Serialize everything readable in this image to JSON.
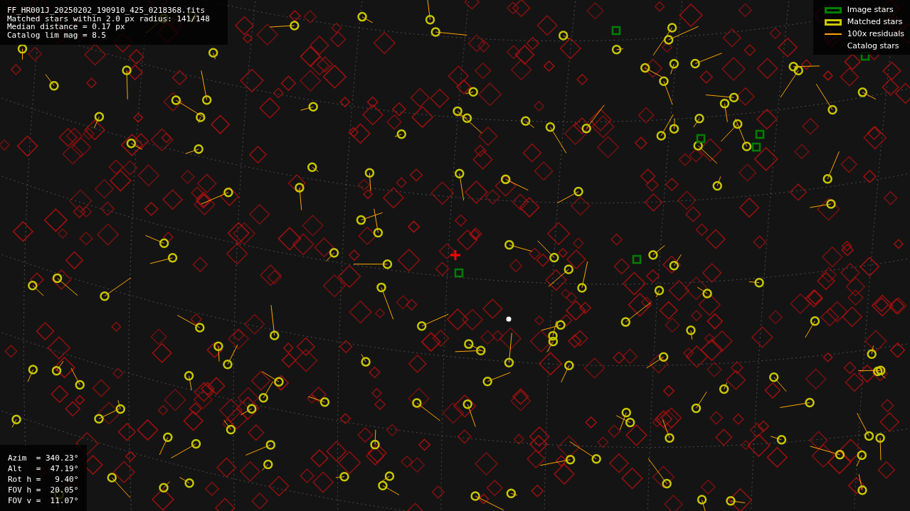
{
  "info": {
    "lines": [
      "FF_HR001J_20250202_190910_425_0218368.fits",
      "Matched stars within 2.0 px radius: 141/148",
      "Median distance = 0.17 px",
      "Catalog lim mag = 8.5"
    ]
  },
  "legend": [
    {
      "kind": "box",
      "color": "#008000",
      "label": "Image stars"
    },
    {
      "kind": "box",
      "color": "#c8c800",
      "label": "Matched stars"
    },
    {
      "kind": "line",
      "color": "#ffa500",
      "label": "100x residuals"
    },
    {
      "kind": "none",
      "label": "Catalog stars"
    }
  ],
  "pointing": {
    "lines": [
      "Azim  = 340.23°",
      "Alt   =  47.19°",
      "Rot h =   9.40°",
      "FOV h =  20.05°",
      "FOV v =  11.07°"
    ]
  }
}
